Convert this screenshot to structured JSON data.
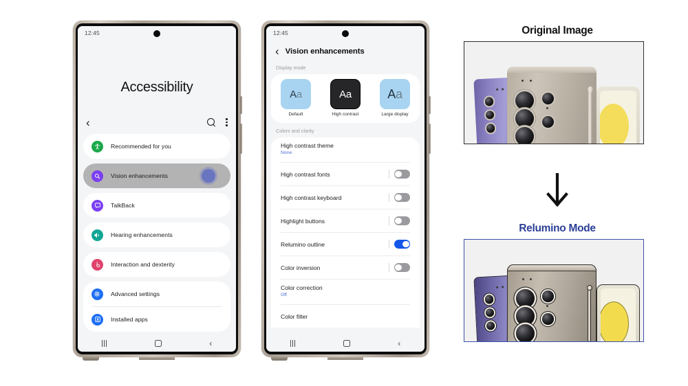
{
  "phone1": {
    "status": {
      "time": "12:45"
    },
    "page_title": "Accessibility",
    "topbar": {
      "back_icon": "chevron-left-icon",
      "search_icon": "search-icon",
      "more_icon": "kebab-menu-icon"
    },
    "items": [
      {
        "label": "Recommended for you",
        "icon": "accessibility-person-icon",
        "color": "#1aa94a",
        "highlighted": false
      },
      {
        "label": "Vision enhancements",
        "icon": "eye-search-icon",
        "color": "#7b3ff2",
        "highlighted": true
      },
      {
        "label": "TalkBack",
        "icon": "speech-bubble-icon",
        "color": "#7b3ff2",
        "highlighted": false
      },
      {
        "label": "Hearing enhancements",
        "icon": "speaker-icon",
        "color": "#12a594",
        "highlighted": false
      },
      {
        "label": "Interaction and dexterity",
        "icon": "hand-tap-icon",
        "color": "#e0436c",
        "highlighted": false
      },
      {
        "label": "Advanced settings",
        "icon": "gear-plus-icon",
        "color": "#1d6ff2",
        "highlighted": false
      },
      {
        "label": "Installed apps",
        "icon": "app-download-icon",
        "color": "#1d6ff2",
        "highlighted": false
      }
    ],
    "navbar": {
      "recents": "recents-icon",
      "home": "home-icon",
      "back": "back-icon"
    }
  },
  "phone2": {
    "status": {
      "time": "12:45"
    },
    "header": {
      "back_icon": "chevron-left-icon",
      "title": "Vision enhancements"
    },
    "display_mode": {
      "section_label": "Display mode",
      "modes": [
        {
          "caption": "Default",
          "sample": "Aa",
          "tile_color": "#a8d4f2"
        },
        {
          "caption": "High contrast",
          "sample": "Aa",
          "tile_color": "#262629"
        },
        {
          "caption": "Large display",
          "sample": "Aa",
          "tile_color": "#a8d4f2"
        }
      ]
    },
    "colors_section_label": "Colors and clarity",
    "settings": [
      {
        "label": "High contrast theme",
        "value": "None",
        "control": "value"
      },
      {
        "label": "High contrast fonts",
        "control": "toggle",
        "on": false
      },
      {
        "label": "High contrast keyboard",
        "control": "toggle",
        "on": false
      },
      {
        "label": "Highlight buttons",
        "control": "toggle",
        "on": false
      },
      {
        "label": "Relumino outline",
        "control": "toggle",
        "on": true
      },
      {
        "label": "Color inversion",
        "control": "toggle",
        "on": false
      },
      {
        "label": "Color correction",
        "value": "Off",
        "control": "value"
      },
      {
        "label": "Color filter",
        "control": "none"
      }
    ],
    "navbar": {
      "recents": "recents-icon",
      "home": "home-icon",
      "back": "back-icon"
    }
  },
  "comparison": {
    "original": {
      "title": "Original Image",
      "title_color": "#111111",
      "border_color": "#2c2c2c"
    },
    "arrow": {
      "icon": "down-arrow-icon",
      "color": "#111111"
    },
    "relumino": {
      "title": "Relumino Mode",
      "title_color": "#2b3f96",
      "border_color": "#3b50a8"
    }
  }
}
